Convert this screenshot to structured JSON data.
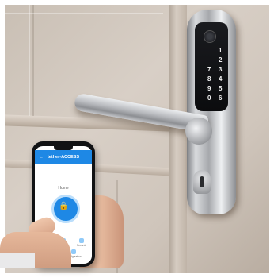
{
  "app": {
    "title": "tether-ACCESS",
    "back_icon": "back-arrow-icon",
    "screen_heading": "Home",
    "lock_icon": "lock-icon",
    "tabs": [
      "Unlock",
      "Users",
      "Records",
      "Register",
      "Configuration"
    ]
  },
  "keypad": {
    "digits": [
      "1",
      "2",
      "3",
      "4",
      "5",
      "6",
      "7",
      "8",
      "9",
      "0"
    ]
  },
  "colors": {
    "accent": "#1e88e5",
    "lock_finish": "#b9bbbf"
  }
}
